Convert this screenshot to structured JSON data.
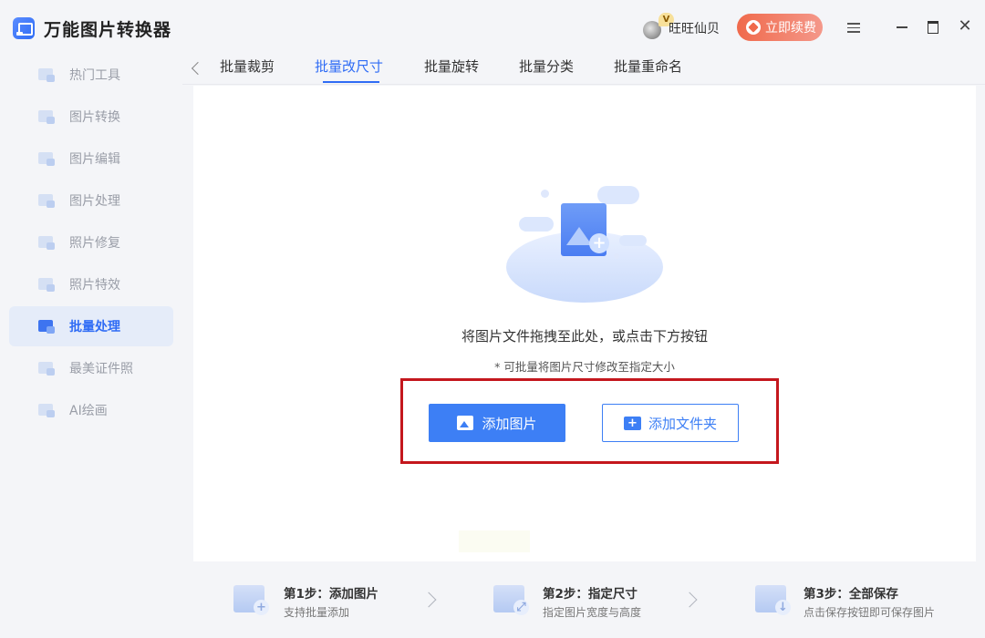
{
  "app": {
    "title": "万能图片转换器"
  },
  "user": {
    "badge": "V",
    "name": "旺旺仙贝"
  },
  "header": {
    "renew_label": "立即续费"
  },
  "sidebar": {
    "items": [
      {
        "label": "热门工具"
      },
      {
        "label": "图片转换"
      },
      {
        "label": "图片编辑"
      },
      {
        "label": "图片处理"
      },
      {
        "label": "照片修复"
      },
      {
        "label": "照片特效"
      },
      {
        "label": "批量处理",
        "active": true
      },
      {
        "label": "最美证件照"
      },
      {
        "label": "AI绘画"
      }
    ]
  },
  "tabs": [
    {
      "label": "批量裁剪"
    },
    {
      "label": "批量改尺寸",
      "active": true
    },
    {
      "label": "批量旋转"
    },
    {
      "label": "批量分类"
    },
    {
      "label": "批量重命名"
    }
  ],
  "main": {
    "drop_text": "将图片文件拖拽至此处，或点击下方按钮",
    "hint": "* 可批量将图片尺寸修改至指定大小",
    "add_image_label": "添加图片",
    "add_folder_label": "添加文件夹"
  },
  "steps": [
    {
      "title": "第1步：添加图片",
      "desc": "支持批量添加"
    },
    {
      "title": "第2步：指定尺寸",
      "desc": "指定图片宽度与高度"
    },
    {
      "title": "第3步：全部保存",
      "desc": "点击保存按钮即可保存图片"
    }
  ],
  "colors": {
    "accent": "#2f6cf5",
    "highlight": "#c4171d",
    "renew": "#f06a4c"
  }
}
